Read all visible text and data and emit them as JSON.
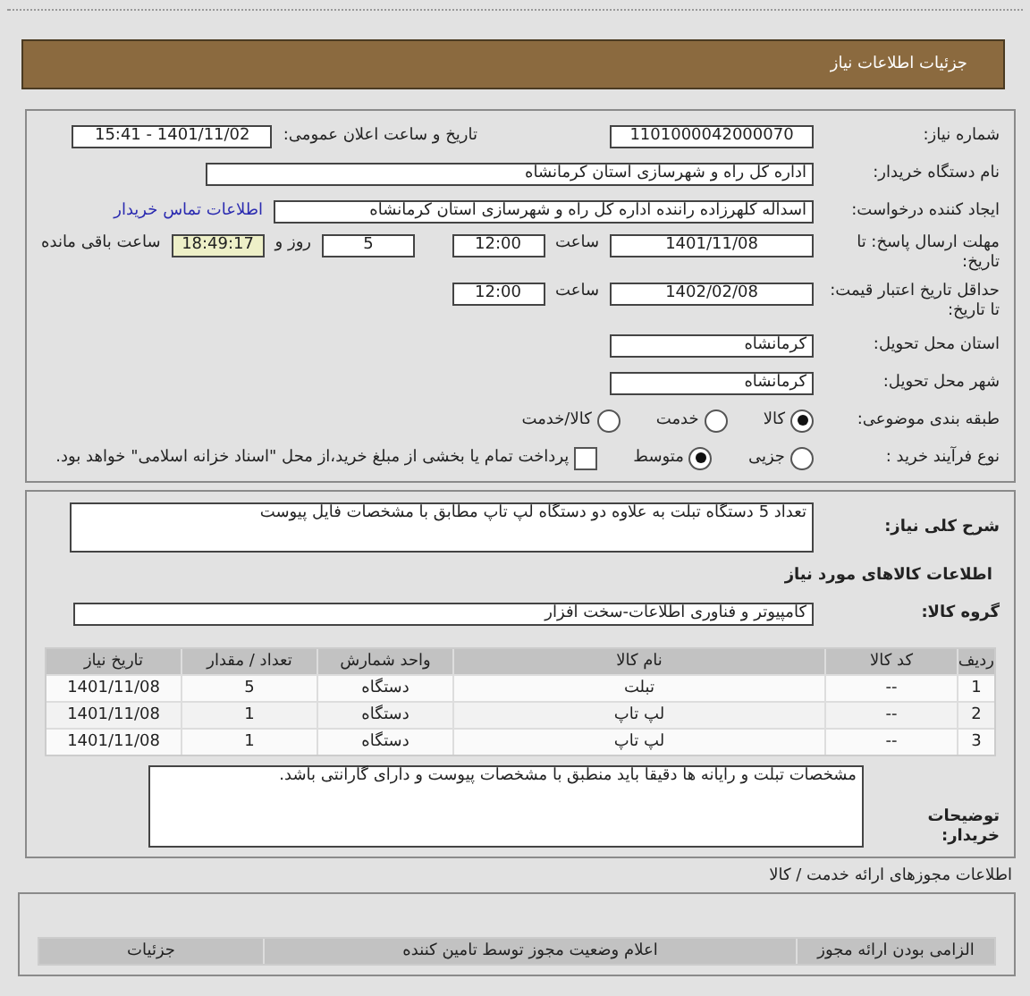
{
  "header": {
    "title": "جزئیات اطلاعات نیاز"
  },
  "need_number": {
    "label": "شماره نیاز:",
    "value": "1101000042000070"
  },
  "announce": {
    "label": "تاریخ و ساعت اعلان عمومی:",
    "value": "1401/11/02 - 15:41"
  },
  "buyer": {
    "label": "نام دستگاه خریدار:",
    "value": "اداره کل راه و شهرسازی استان کرمانشاه"
  },
  "creator": {
    "label": "ایجاد کننده درخواست:",
    "value": "اسداله کلهرزاده راننده اداره کل راه و شهرسازی استان کرمانشاه",
    "link": "اطلاعات تماس خریدار"
  },
  "deadline": {
    "label": "مهلت ارسال پاسخ: تا تاریخ:",
    "date": "1401/11/08",
    "time_label": "ساعت",
    "time": "12:00",
    "days": "5",
    "days_label": "روز و",
    "remaining": "18:49:17",
    "remaining_label": "ساعت باقی مانده"
  },
  "validity": {
    "label": "حداقل تاریخ اعتبار قیمت: تا تاریخ:",
    "date": "1402/02/08",
    "time_label": "ساعت",
    "time": "12:00"
  },
  "province": {
    "label": "استان محل تحویل:",
    "value": "کرمانشاه"
  },
  "city": {
    "label": "شهر محل تحویل:",
    "value": "کرمانشاه"
  },
  "category": {
    "label": "طبقه بندی موضوعی:",
    "options": [
      {
        "label": "کالا",
        "selected": true
      },
      {
        "label": "خدمت",
        "selected": false
      },
      {
        "label": "کالا/خدمت",
        "selected": false
      }
    ]
  },
  "process": {
    "label": "نوع فرآیند خرید :",
    "options": [
      {
        "label": "جزیی",
        "selected": false
      },
      {
        "label": "متوسط",
        "selected": true
      }
    ],
    "payment": {
      "checked": false,
      "label": "پرداخت تمام یا بخشی از مبلغ خرید،از محل \"اسناد خزانه اسلامی\" خواهد بود."
    }
  },
  "summary": {
    "label": "شرح کلی نیاز:",
    "value": "تعداد 5 دستگاه تبلت به علاوه دو دستگاه لپ تاپ مطابق با مشخصات فایل پیوست"
  },
  "goods_title": "اطلاعات کالاهای مورد نیاز",
  "group": {
    "label": "گروه کالا:",
    "value": "کامپیوتر و فناوری اطلاعات-سخت افزار"
  },
  "table": {
    "columns": [
      "ردیف",
      "کد کالا",
      "نام کالا",
      "واحد شمارش",
      "تعداد / مقدار",
      "تاریخ نیاز"
    ],
    "rows": [
      [
        "1",
        "--",
        "تبلت",
        "دستگاه",
        "5",
        "1401/11/08"
      ],
      [
        "2",
        "--",
        "لپ تاپ",
        "دستگاه",
        "1",
        "1401/11/08"
      ],
      [
        "3",
        "--",
        "لپ تاپ",
        "دستگاه",
        "1",
        "1401/11/08"
      ]
    ]
  },
  "notes": {
    "label": "توضیحات خریدار:",
    "value": "مشخصات تبلت و رایانه ها دقیقا باید منطبق با مشخصات پیوست و دارای گارانتی باشد."
  },
  "licenses": {
    "title": "اطلاعات مجوزهای ارائه خدمت / کالا",
    "columns": [
      "الزامی بودن ارائه مجوز",
      "اعلام وضعیت مجوز توسط تامین کننده",
      "جزئیات"
    ]
  }
}
